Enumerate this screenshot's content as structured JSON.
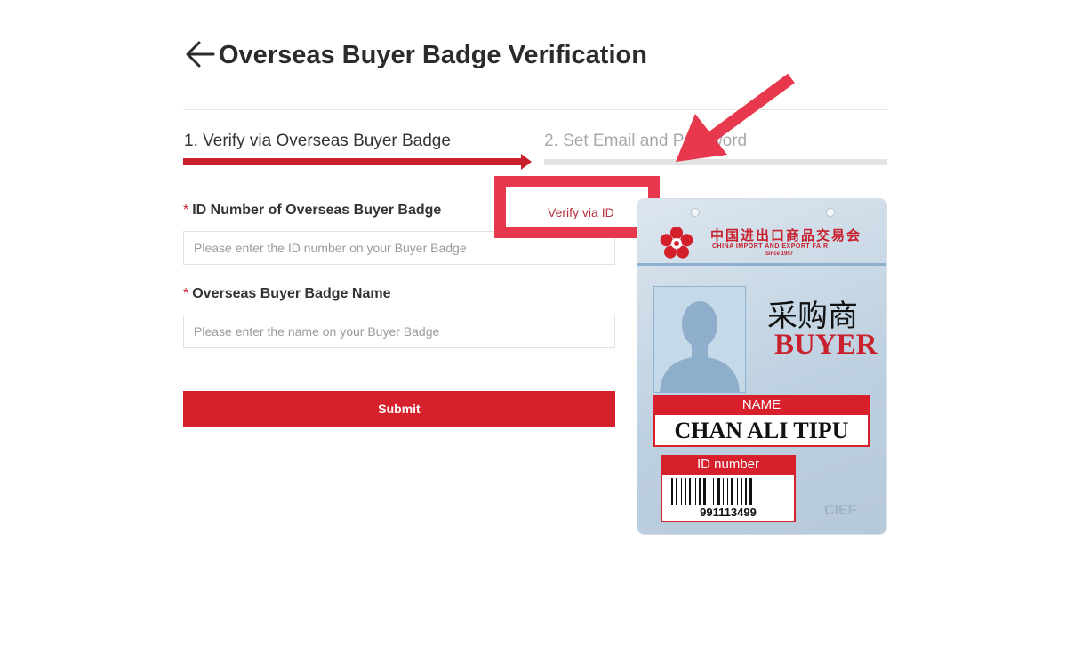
{
  "header": {
    "title": "Overseas Buyer Badge Verification"
  },
  "steps": [
    {
      "label": "1. Verify via Overseas Buyer Badge",
      "active": true
    },
    {
      "label": "2. Set Email and Password",
      "active": false
    }
  ],
  "form": {
    "id_field": {
      "required_mark": "*",
      "label": "ID Number of Overseas Buyer Badge",
      "placeholder": "Please enter the ID number on your Buyer Badge",
      "value": ""
    },
    "name_field": {
      "required_mark": "*",
      "label": "Overseas Buyer Badge Name",
      "placeholder": "Please enter the name on your Buyer Badge",
      "value": ""
    },
    "submit_label": "Submit"
  },
  "verify_link": "Verify via ID",
  "badge": {
    "fair_name_cn": "中国进出口商品交易会",
    "fair_name_en": "CHINA IMPORT AND EXPORT FAIR",
    "since": "Since 1957",
    "role_cn": "采购商",
    "role": "BUYER",
    "name_header": "NAME",
    "name_value": "CHAN ALI TIPU",
    "id_header": "ID number",
    "id_value": "991113499",
    "watermark": "CIEF"
  },
  "colors": {
    "brand_red": "#d4212b",
    "highlight": "#e8384e",
    "step_inactive": "#e3e3e3"
  },
  "icons": {
    "back": "arrow-left-icon",
    "annotation": "red-arrow-icon",
    "logo": "flower-logo-icon",
    "barcode": "barcode-icon"
  }
}
